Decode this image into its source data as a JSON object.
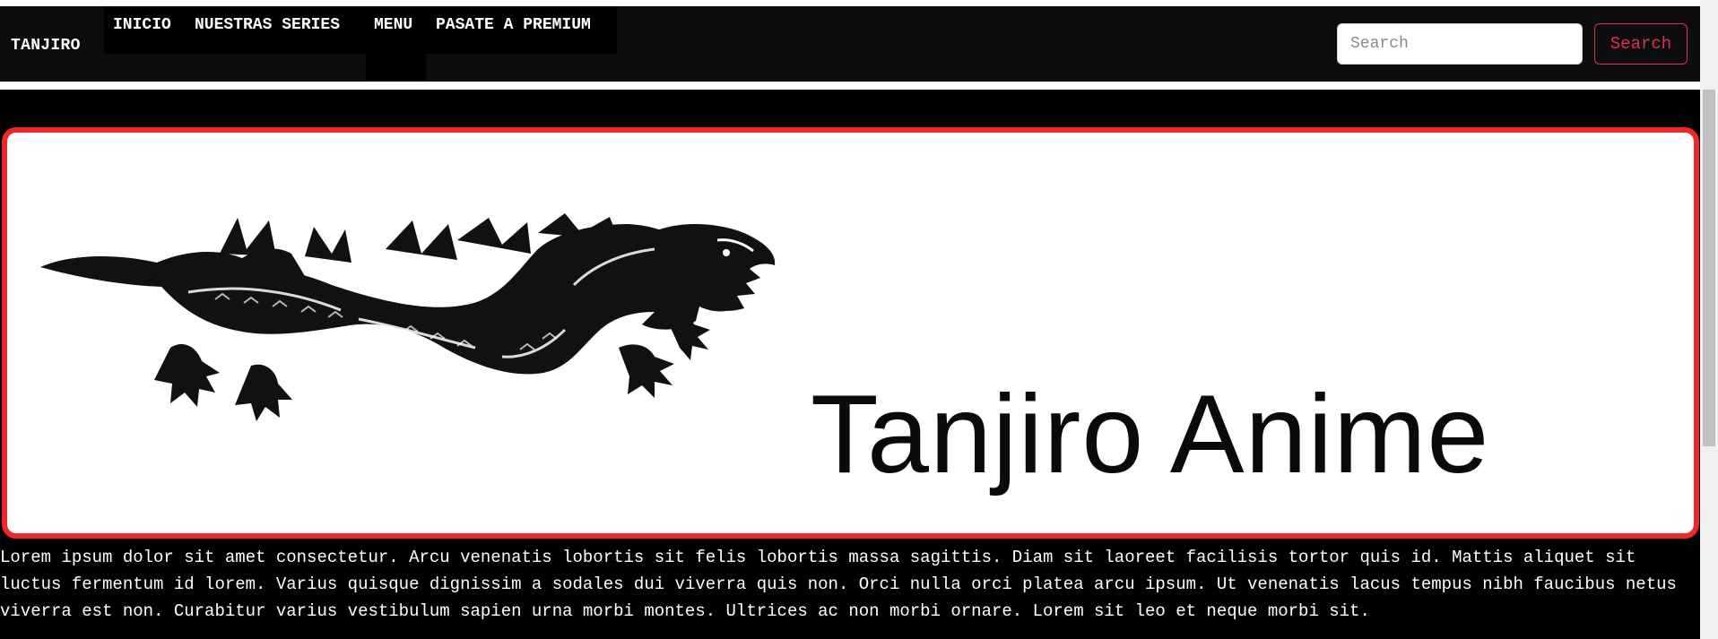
{
  "navbar": {
    "brand": "TANJIRO",
    "links": [
      {
        "label": "INICIO"
      },
      {
        "label": "NUESTRAS SERIES"
      },
      {
        "label": "MENU"
      },
      {
        "label": "PASATE A PREMIUM"
      }
    ],
    "search": {
      "placeholder": "Search",
      "value": "",
      "button_label": "Search"
    }
  },
  "banner": {
    "logo_icon": "dragon-icon",
    "title": "Tanjiro Anime",
    "border_color": "#ee2727"
  },
  "main": {
    "paragraph": "Lorem ipsum dolor sit amet consectetur. Arcu venenatis lobortis sit felis lobortis massa sagittis. Diam sit laoreet facilisis tortor quis id. Mattis aliquet sit luctus fermentum id lorem. Varius quisque dignissim a sodales dui viverra quis non. Orci nulla orci platea arcu ipsum. Ut venenatis lacus tempus nibh faucibus netus viverra est non. Curabitur varius vestibulum sapien urna morbi montes. Ultrices ac non morbi ornare. Lorem sit leo et neque morbi sit."
  },
  "colors": {
    "accent": "#dc3545",
    "navbar_bg": "#0d0d0f",
    "page_bg": "#000000"
  }
}
